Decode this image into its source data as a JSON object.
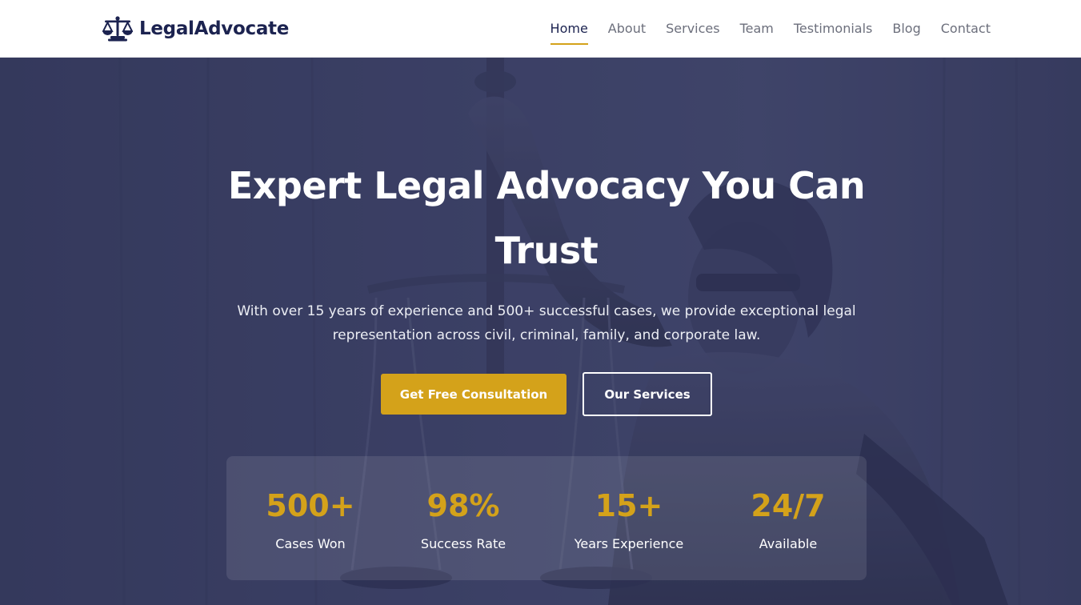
{
  "brand": {
    "name": "LegalAdvocate",
    "logo_icon": "scales-of-justice-icon",
    "color": "#1c2350"
  },
  "nav": {
    "items": [
      {
        "label": "Home",
        "active": true
      },
      {
        "label": "About",
        "active": false
      },
      {
        "label": "Services",
        "active": false
      },
      {
        "label": "Team",
        "active": false
      },
      {
        "label": "Testimonials",
        "active": false
      },
      {
        "label": "Blog",
        "active": false
      },
      {
        "label": "Contact",
        "active": false
      }
    ]
  },
  "hero": {
    "title": "Expert Legal Advocacy You Can Trust",
    "subtitle": "With over 15 years of experience and 500+ successful cases, we provide exceptional legal representation across civil, criminal, family, and corporate law.",
    "primary_button": "Get Free Consultation",
    "secondary_button": "Our Services",
    "background_image": "lady-justice-statue-image"
  },
  "stats": [
    {
      "value": "500+",
      "label": "Cases Won"
    },
    {
      "value": "98%",
      "label": "Success Rate"
    },
    {
      "value": "15+",
      "label": "Years Experience"
    },
    {
      "value": "24/7",
      "label": "Available"
    }
  ],
  "colors": {
    "accent": "#d4a21a",
    "hero_overlay": "#3c4266",
    "header_bg": "#ffffff"
  }
}
